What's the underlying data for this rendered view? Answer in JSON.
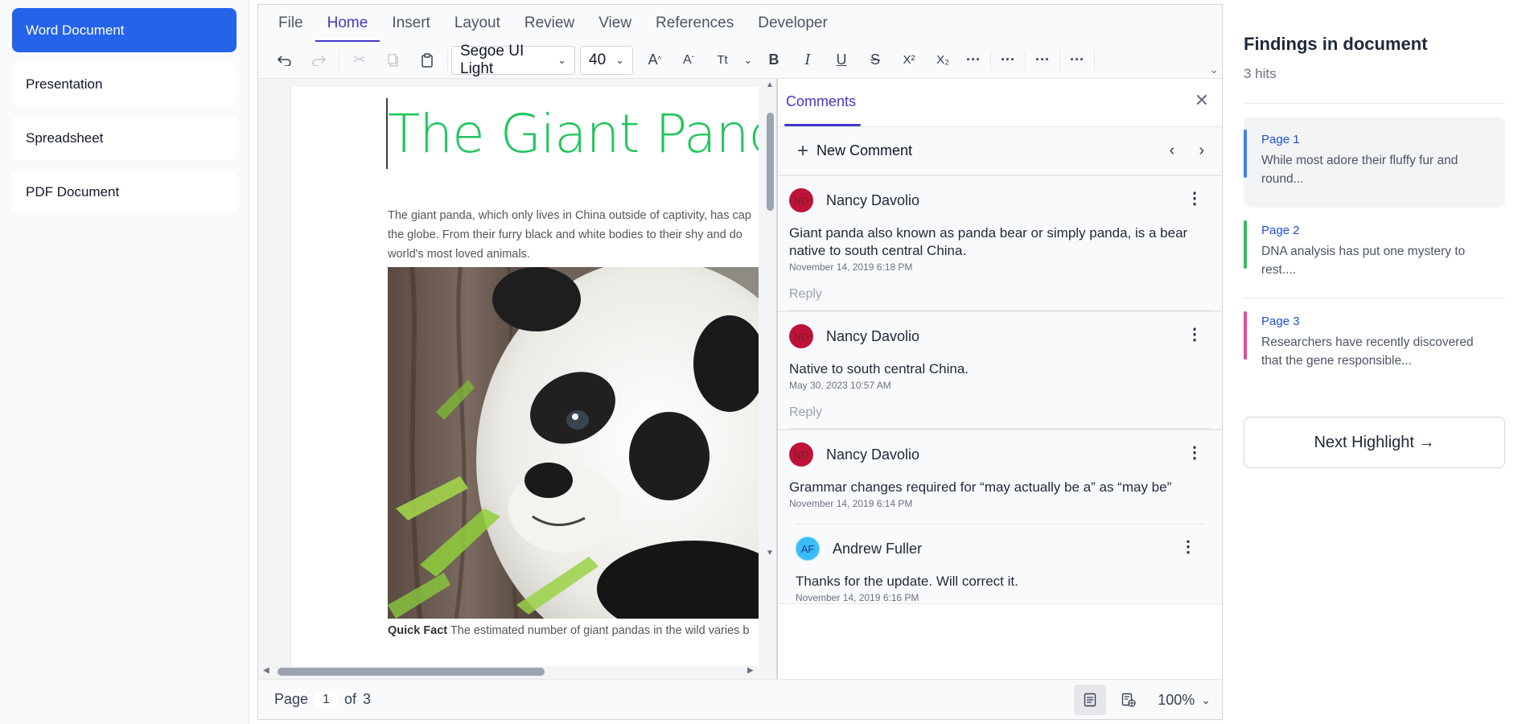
{
  "leftnav": {
    "items": [
      {
        "label": "Word Document"
      },
      {
        "label": "Presentation"
      },
      {
        "label": "Spreadsheet"
      },
      {
        "label": "PDF Document"
      }
    ]
  },
  "menubar": {
    "items": [
      "File",
      "Home",
      "Insert",
      "Layout",
      "Review",
      "View",
      "References",
      "Developer"
    ],
    "active": "Home"
  },
  "toolbar": {
    "font_family": "Segoe UI Light",
    "font_size": "40",
    "icons": [
      "undo-icon",
      "redo-icon",
      "cut-icon",
      "copy-icon",
      "paste-icon",
      "grow-font-icon",
      "shrink-font-icon",
      "change-case-icon",
      "bold-icon",
      "italic-icon",
      "underline-icon",
      "strikethrough-icon",
      "superscript-icon",
      "subscript-icon",
      "more-icon"
    ]
  },
  "document": {
    "title": "The Giant Panda",
    "title_color": "#22c55e",
    "para_line1": "The giant panda, which only lives in China outside of captivity, has cap",
    "para_line2": "the globe. From their furry black and white bodies to their shy and do",
    "para_line3": "world's most loved animals.",
    "caption_bold": "Quick Fact",
    "caption_text": " The estimated number of giant pandas in the wild varies b"
  },
  "comments": {
    "tab": "Comments",
    "new_comment": "New Comment",
    "reply": "Reply",
    "list": [
      {
        "initials": "ND",
        "author": "Nancy Davolio",
        "text": "Giant panda also known as panda bear or simply panda, is a bear native to south central China.",
        "date": "November 14, 2019 6:18 PM"
      },
      {
        "initials": "ND",
        "author": "Nancy Davolio",
        "text": "Native to south central China.",
        "date": "May 30, 2023 10:57 AM"
      },
      {
        "initials": "ND",
        "author": "Nancy Davolio",
        "text": "Grammar changes required for “may actually be a” as “may be”",
        "date": "November 14, 2019 6:14 PM",
        "reply_item": {
          "initials": "AF",
          "author": "Andrew Fuller",
          "text": "Thanks for the update. Will correct it.",
          "date": "November 14, 2019 6:16 PM"
        }
      }
    ]
  },
  "statusbar": {
    "page_label": "Page",
    "page_current": "1",
    "of_label": "of",
    "page_total": "3",
    "zoom": "100%"
  },
  "findings": {
    "title": "Findings in document",
    "count": "3 hits",
    "hits": [
      {
        "page": "Page 1",
        "text": "While most adore their fluffy fur and round...",
        "color": "#3b82f6"
      },
      {
        "page": "Page 2",
        "text": "DNA analysis has put one mystery to rest....",
        "color": "#22c55e"
      },
      {
        "page": "Page 3",
        "text": "Researchers have recently discovered that the gene responsible...",
        "color": "#ec4899"
      }
    ],
    "next_button": "Next Highlight →"
  },
  "colors": {
    "accent": "#2563eb",
    "tab_accent": "#4338ca"
  }
}
